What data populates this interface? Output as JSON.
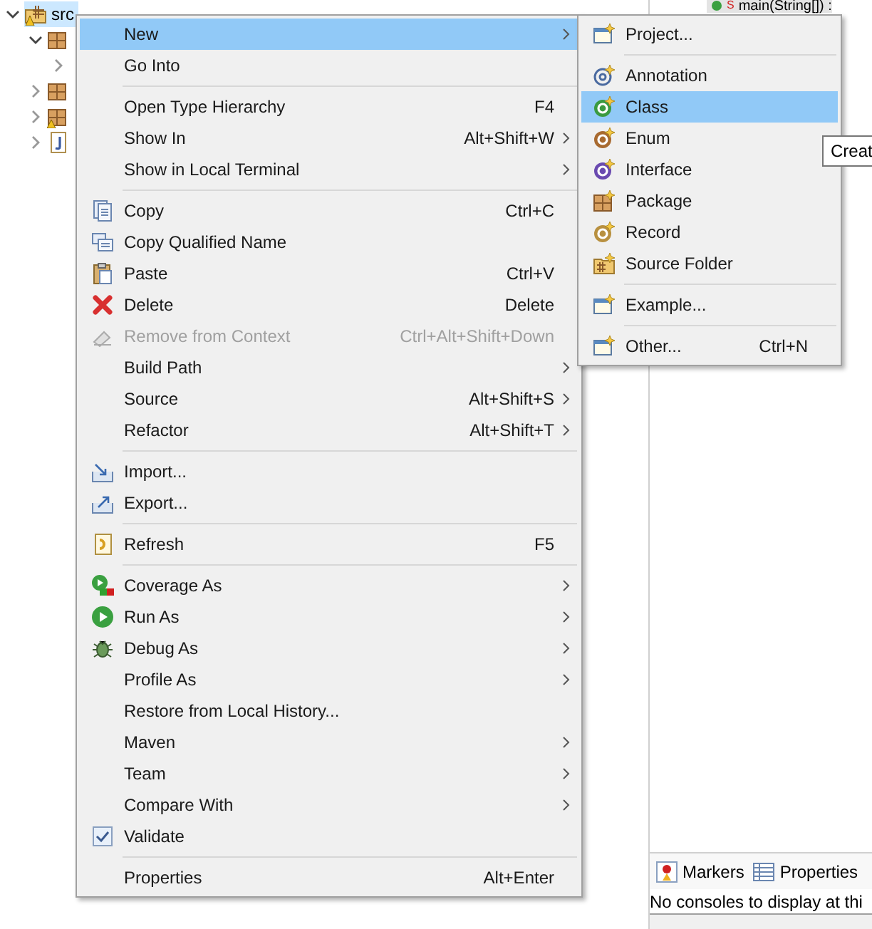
{
  "tree": [
    {
      "kind": "source-folder",
      "label": "src",
      "expanded": true,
      "selected": true,
      "children": [
        {
          "kind": "package",
          "expanded": true,
          "selected": false,
          "children": [
            {
              "expanded": false
            }
          ]
        },
        {
          "kind": "package",
          "expanded": false,
          "selected": false
        },
        {
          "kind": "package-warning",
          "expanded": false,
          "selected": false
        },
        {
          "kind": "java-file",
          "expanded": false,
          "selected": false
        }
      ]
    }
  ],
  "outline": {
    "label": "main(String[]) :",
    "badge": "S"
  },
  "context_menu": [
    {
      "kind": "plain",
      "label": "New",
      "submenu": true,
      "selected": true,
      "disabled": false
    },
    {
      "kind": "plain",
      "label": "Go Into",
      "submenu": false,
      "selected": false,
      "disabled": false
    },
    {
      "kind": "separator"
    },
    {
      "kind": "plain",
      "label": "Open Type Hierarchy",
      "shortcut": "F4",
      "submenu": false,
      "selected": false,
      "disabled": false
    },
    {
      "kind": "plain",
      "label": "Show In",
      "shortcut": "Alt+Shift+W",
      "submenu": true,
      "selected": false,
      "disabled": false
    },
    {
      "kind": "plain",
      "label": "Show in Local Terminal",
      "submenu": true,
      "selected": false,
      "disabled": false
    },
    {
      "kind": "separator"
    },
    {
      "kind": "copy",
      "label": "Copy",
      "shortcut": "Ctrl+C",
      "submenu": false,
      "selected": false,
      "disabled": false
    },
    {
      "kind": "copyname",
      "label": "Copy Qualified Name",
      "submenu": false,
      "selected": false,
      "disabled": false
    },
    {
      "kind": "paste",
      "label": "Paste",
      "shortcut": "Ctrl+V",
      "submenu": false,
      "selected": false,
      "disabled": false
    },
    {
      "kind": "delete",
      "label": "Delete",
      "shortcut": "Delete",
      "submenu": false,
      "selected": false,
      "disabled": false
    },
    {
      "kind": "remove",
      "label": "Remove from Context",
      "shortcut": "Ctrl+Alt+Shift+Down",
      "submenu": false,
      "selected": false,
      "disabled": true
    },
    {
      "kind": "plain",
      "label": "Build Path",
      "submenu": true,
      "selected": false,
      "disabled": false
    },
    {
      "kind": "plain",
      "label": "Source",
      "shortcut": "Alt+Shift+S",
      "submenu": true,
      "selected": false,
      "disabled": false
    },
    {
      "kind": "plain",
      "label": "Refactor",
      "shortcut": "Alt+Shift+T",
      "submenu": true,
      "selected": false,
      "disabled": false
    },
    {
      "kind": "separator"
    },
    {
      "kind": "import",
      "label": "Import...",
      "submenu": false,
      "selected": false,
      "disabled": false
    },
    {
      "kind": "export",
      "label": "Export...",
      "submenu": false,
      "selected": false,
      "disabled": false
    },
    {
      "kind": "separator"
    },
    {
      "kind": "refresh",
      "label": "Refresh",
      "shortcut": "F5",
      "submenu": false,
      "selected": false,
      "disabled": false
    },
    {
      "kind": "separator"
    },
    {
      "kind": "coverage",
      "label": "Coverage As",
      "submenu": true,
      "selected": false,
      "disabled": false
    },
    {
      "kind": "run",
      "label": "Run As",
      "submenu": true,
      "selected": false,
      "disabled": false
    },
    {
      "kind": "debug",
      "label": "Debug As",
      "submenu": true,
      "selected": false,
      "disabled": false
    },
    {
      "kind": "plain",
      "label": "Profile As",
      "submenu": true,
      "selected": false,
      "disabled": false
    },
    {
      "kind": "plain",
      "label": "Restore from Local History...",
      "submenu": false,
      "selected": false,
      "disabled": false
    },
    {
      "kind": "plain",
      "label": "Maven",
      "submenu": true,
      "selected": false,
      "disabled": false
    },
    {
      "kind": "plain",
      "label": "Team",
      "submenu": true,
      "selected": false,
      "disabled": false
    },
    {
      "kind": "plain",
      "label": "Compare With",
      "submenu": true,
      "selected": false,
      "disabled": false
    },
    {
      "kind": "checkbox",
      "label": "Validate",
      "checked": true,
      "submenu": false,
      "selected": false,
      "disabled": false
    },
    {
      "kind": "separator"
    },
    {
      "kind": "plain",
      "label": "Properties",
      "shortcut": "Alt+Enter",
      "submenu": false,
      "selected": false,
      "disabled": false
    }
  ],
  "submenu": [
    {
      "kind": "wizard",
      "label": "Project...",
      "selected": false
    },
    {
      "kind": "separator"
    },
    {
      "kind": "annotation",
      "label": "Annotation",
      "selected": false
    },
    {
      "kind": "class",
      "label": "Class",
      "selected": true
    },
    {
      "kind": "enum",
      "label": "Enum",
      "selected": false
    },
    {
      "kind": "interface",
      "label": "Interface",
      "selected": false
    },
    {
      "kind": "package",
      "label": "Package",
      "selected": false
    },
    {
      "kind": "record",
      "label": "Record",
      "selected": false
    },
    {
      "kind": "sourcefolder",
      "label": "Source Folder",
      "selected": false
    },
    {
      "kind": "separator"
    },
    {
      "kind": "wizard",
      "label": "Example...",
      "selected": false
    },
    {
      "kind": "separator"
    },
    {
      "kind": "wizard",
      "label": "Other...",
      "shortcut": "Ctrl+N",
      "selected": false
    }
  ],
  "tooltip": "Creat",
  "bottom_tabs": [
    {
      "kind": "markers",
      "label": "Markers"
    },
    {
      "kind": "properties",
      "label": "Properties"
    }
  ],
  "console_message": "No consoles to display at thi"
}
